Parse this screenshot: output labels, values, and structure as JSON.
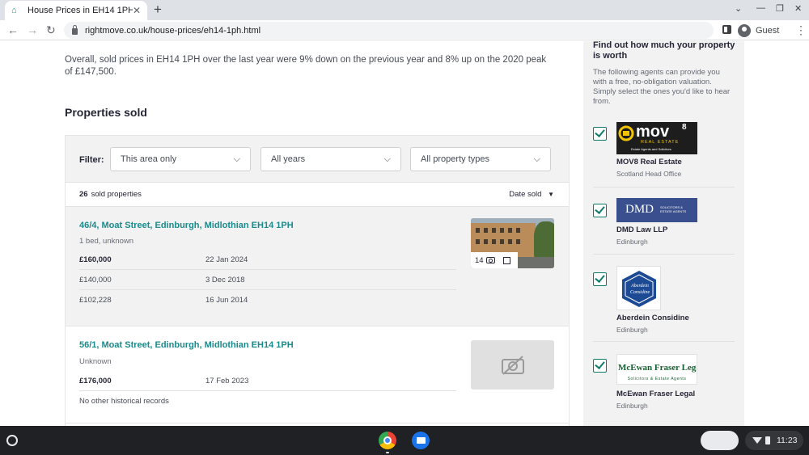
{
  "browser": {
    "tab_title": "House Prices in EH14 1PH",
    "url": "rightmove.co.uk/house-prices/eh14-1ph.html",
    "profile_label": "Guest"
  },
  "page": {
    "intro": "Overall, sold prices in EH14 1PH over the last year were 9% down on the previous year and 8% up on the 2020 peak of £147,500.",
    "section_title": "Properties sold",
    "filter": {
      "label": "Filter:",
      "area": "This area only",
      "years": "All years",
      "types": "All property types"
    },
    "count_number": "26",
    "count_label": "sold properties",
    "sort_label": "Date sold",
    "properties": [
      {
        "address": "46/4, Moat Street, Edinburgh, Midlothian EH14 1PH",
        "type": "1 bed, unknown",
        "photo_count": "14",
        "transactions": [
          {
            "price": "£160,000",
            "date": "22 Jan 2024"
          },
          {
            "price": "£140,000",
            "date": "3 Dec 2018"
          },
          {
            "price": "£102,228",
            "date": "16 Jun 2014"
          }
        ]
      },
      {
        "address": "56/1, Moat Street, Edinburgh, Midlothian EH14 1PH",
        "type": "Unknown",
        "transactions": [
          {
            "price": "£176,000",
            "date": "17 Feb 2023"
          }
        ],
        "no_history": "No other historical records"
      }
    ]
  },
  "sidebar": {
    "title": "Find out how much your property is worth",
    "description": "The following agents can provide you with a free, no-obligation valuation. Simply select the ones you'd like to hear from.",
    "agents": [
      {
        "name": "MOV8 Real Estate",
        "office": "Scotland Head Office",
        "logo_text": "mov",
        "logo_sup": "8",
        "logo_sub": "REAL ESTATE",
        "logo_tag": "Estate Agents and Solicitors"
      },
      {
        "name": "DMD Law LLP",
        "office": "Edinburgh",
        "logo_text": "DMD",
        "logo_sub": "SOLICITORS & ESTATE AGENTS"
      },
      {
        "name": "Aberdein Considine",
        "office": "Edinburgh",
        "logo_text": "Aberdein Considine"
      },
      {
        "name": "McEwan Fraser Legal",
        "office": "Edinburgh",
        "logo_text": "McEwan Fraser Legal",
        "logo_sub": "Solicitors & Estate Agents"
      }
    ]
  },
  "shelf": {
    "time": "11:23"
  },
  "colors": {
    "accent_teal": "#1a8a8c",
    "checkbox_green": "#0e7c6b",
    "panel_grey": "#f2f2f2"
  }
}
